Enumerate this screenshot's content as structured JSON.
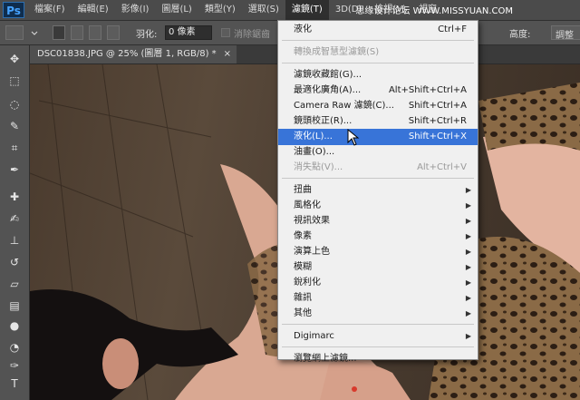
{
  "app_logo": "Ps",
  "menubar": {
    "items": [
      "檔案(F)",
      "編輯(E)",
      "影像(I)",
      "圖層(L)",
      "類型(Y)",
      "選取(S)",
      "濾鏡(T)",
      "3D(D)",
      "檢視(V)",
      "視窗"
    ],
    "active_index": 6
  },
  "watermark": "思缘设计论坛 WWW.MISSYUAN.COM",
  "optionsbar": {
    "feather_label": "羽化:",
    "feather_value": "0 像素",
    "antialias_label": "消除鋸齒",
    "height_label": "高度:",
    "adjust_label": "調整"
  },
  "document_tab": "DSC01838.JPG @ 25% (圖層 1, RGB/8) *",
  "filter_menu": {
    "items": [
      {
        "label": "液化",
        "shortcut": "Ctrl+F",
        "state": "normal"
      },
      {
        "separator": true
      },
      {
        "label": "轉換成智慧型濾鏡(S)",
        "shortcut": "",
        "state": "disabled"
      },
      {
        "separator": true
      },
      {
        "label": "濾鏡收藏館(G)...",
        "shortcut": "",
        "state": "normal"
      },
      {
        "label": "最適化廣角(A)...",
        "shortcut": "Alt+Shift+Ctrl+A",
        "state": "normal"
      },
      {
        "label": "Camera Raw 濾鏡(C)...",
        "shortcut": "Shift+Ctrl+A",
        "state": "normal"
      },
      {
        "label": "鏡頭校正(R)...",
        "shortcut": "Shift+Ctrl+R",
        "state": "normal"
      },
      {
        "label": "液化(L)...",
        "shortcut": "Shift+Ctrl+X",
        "state": "highlighted"
      },
      {
        "label": "油畫(O)...",
        "shortcut": "",
        "state": "normal"
      },
      {
        "label": "消失點(V)...",
        "shortcut": "Alt+Ctrl+V",
        "state": "disabled"
      },
      {
        "separator": true
      },
      {
        "label": "扭曲",
        "submenu": true,
        "state": "normal"
      },
      {
        "label": "風格化",
        "submenu": true,
        "state": "normal"
      },
      {
        "label": "視訊效果",
        "submenu": true,
        "state": "normal"
      },
      {
        "label": "像素",
        "submenu": true,
        "state": "normal"
      },
      {
        "label": "演算上色",
        "submenu": true,
        "state": "normal"
      },
      {
        "label": "模糊",
        "submenu": true,
        "state": "normal"
      },
      {
        "label": "銳利化",
        "submenu": true,
        "state": "normal"
      },
      {
        "label": "雜訊",
        "submenu": true,
        "state": "normal"
      },
      {
        "label": "其他",
        "submenu": true,
        "state": "normal"
      },
      {
        "separator": true
      },
      {
        "label": "Digimarc",
        "submenu": true,
        "state": "normal"
      },
      {
        "separator": true
      },
      {
        "label": "瀏覽網上濾鏡...",
        "shortcut": "",
        "state": "normal"
      }
    ]
  },
  "tools": [
    "move-icon",
    "marquee-icon",
    "lasso-icon",
    "quick-select-icon",
    "crop-icon",
    "eyedropper-icon",
    "healing-icon",
    "brush-icon",
    "stamp-icon",
    "history-brush-icon",
    "eraser-icon",
    "gradient-icon",
    "blur-icon",
    "dodge-icon",
    "pen-icon",
    "type-icon"
  ],
  "colors": {
    "menu_highlight": "#3874d8",
    "menu_bg": "#f0f0f0",
    "ui_dark": "#535353"
  }
}
